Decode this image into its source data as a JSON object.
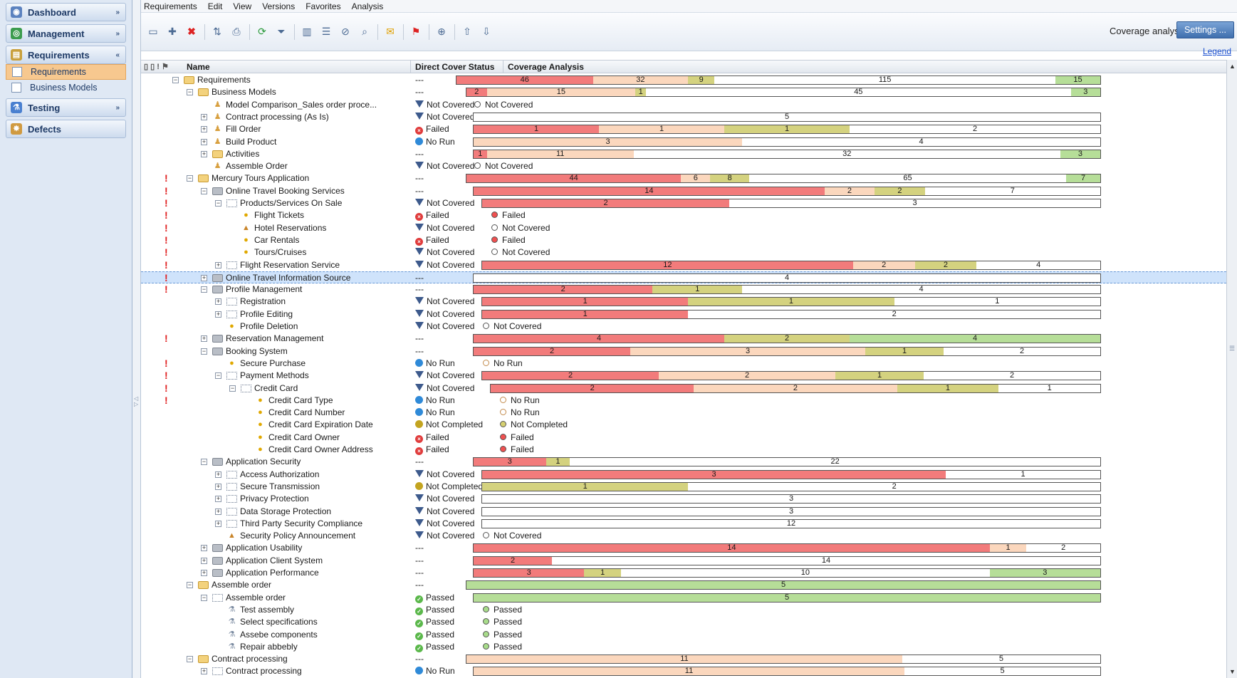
{
  "sidebar": {
    "items": [
      {
        "label": "Dashboard",
        "icon": "dashboard-icon",
        "chev": "»",
        "color": "#5b82bf"
      },
      {
        "label": "Management",
        "icon": "management-icon",
        "chev": "»",
        "color": "#3c9c4e"
      },
      {
        "label": "Requirements",
        "icon": "requirements-icon",
        "chev": "«",
        "color": "#c9a03c"
      },
      {
        "label": "Testing",
        "icon": "testing-icon",
        "chev": "»",
        "color": "#4a80d0"
      },
      {
        "label": "Defects",
        "icon": "defects-icon",
        "chev": "",
        "color": "#d09a40"
      }
    ],
    "sub": [
      "Requirements",
      "Business Models"
    ]
  },
  "menu": [
    "Requirements",
    "Edit",
    "View",
    "Versions",
    "Favorites",
    "Analysis"
  ],
  "toolbar": {
    "coverage_label": "Coverage analysis",
    "settings_label": "Settings ...",
    "legend_label": "Legend"
  },
  "columns": {
    "icons": "▯ ▯ ! ⚑",
    "name": "Name",
    "status": "Direct Cover Status",
    "coverage": "Coverage Analysis"
  },
  "colors": {
    "failed": "#f27b7b",
    "not_covered": "#fbd7bd",
    "not_completed": "#d4d27f",
    "passed": "#b6de98",
    "no_run": "#ffffff"
  },
  "rows": [
    {
      "lvl": 0,
      "exp": "-",
      "icon": "folder",
      "name": "Requirements",
      "status": "---",
      "bar": {
        "start": 0,
        "end": 1526,
        "segs": [
          [
            "f",
            "46",
            192
          ],
          [
            "nc",
            "32",
            134
          ],
          [
            "ncm",
            "9",
            37
          ],
          [
            "nr",
            "115",
            480
          ],
          [
            "p",
            "15",
            63
          ]
        ]
      }
    },
    {
      "lvl": 1,
      "exp": "-",
      "icon": "folder",
      "name": "Business Models",
      "status": "---",
      "bar": {
        "start": 0,
        "end": 1526,
        "segs": [
          [
            "f",
            "2",
            29
          ],
          [
            "nc",
            "15",
            212
          ],
          [
            "ncm",
            "1",
            15
          ],
          [
            "nr",
            "45",
            606
          ],
          [
            "p",
            "3",
            42
          ]
        ]
      }
    },
    {
      "lvl": 2,
      "exp": "",
      "icon": "person",
      "name": "Model Comparison_Sales order proce...",
      "status": "Not Covered",
      "st": "nc",
      "dot": {
        "cls": "nc",
        "label": "Not Covered"
      }
    },
    {
      "lvl": 2,
      "exp": "+",
      "icon": "person",
      "name": "Contract processing (As Is)",
      "status": "Not Covered",
      "st": "nc",
      "bar": {
        "segs": [
          [
            "nr",
            "5",
            1
          ]
        ]
      }
    },
    {
      "lvl": 2,
      "exp": "+",
      "icon": "person",
      "name": "Fill Order",
      "status": "Failed",
      "st": "failed",
      "bar": {
        "segs": [
          [
            "f",
            "1",
            1
          ],
          [
            "nc",
            "1",
            1
          ],
          [
            "ncm",
            "1",
            1
          ],
          [
            "nr",
            "2",
            2
          ]
        ]
      }
    },
    {
      "lvl": 2,
      "exp": "+",
      "icon": "person",
      "name": "Build Product",
      "status": "No Run",
      "st": "norun",
      "bar": {
        "segs": [
          [
            "nc",
            "3",
            3
          ],
          [
            "nr",
            "4",
            4
          ]
        ]
      }
    },
    {
      "lvl": 2,
      "exp": "+",
      "icon": "folder",
      "name": "Activities",
      "status": "---",
      "bar": {
        "segs": [
          [
            "f",
            "1",
            1
          ],
          [
            "nc",
            "11",
            11
          ],
          [
            "nr",
            "32",
            32
          ],
          [
            "p",
            "3",
            3
          ]
        ]
      }
    },
    {
      "lvl": 2,
      "exp": "",
      "icon": "person",
      "name": "Assemble Order",
      "status": "Not Covered",
      "st": "nc",
      "dot": {
        "cls": "nc",
        "label": "Not Covered"
      }
    },
    {
      "lvl": 1,
      "exp": "-",
      "icon": "folder",
      "name": "Mercury Tours Application",
      "status": "---",
      "mark": true,
      "bar": {
        "segs": [
          [
            "f",
            "44",
            44
          ],
          [
            "nc",
            "6",
            6
          ],
          [
            "ncm",
            "8",
            8
          ],
          [
            "nr",
            "65",
            65
          ],
          [
            "p",
            "7",
            7
          ]
        ]
      }
    },
    {
      "lvl": 2,
      "exp": "-",
      "icon": "gray",
      "name": "Online Travel Booking Services",
      "status": "---",
      "mark": true,
      "bar": {
        "segs": [
          [
            "f",
            "14",
            14
          ],
          [
            "nc",
            "2",
            2
          ],
          [
            "ncm",
            "2",
            2
          ],
          [
            "nr",
            "7",
            7
          ]
        ]
      }
    },
    {
      "lvl": 3,
      "exp": "-",
      "icon": "dots",
      "name": "Products/Services On Sale",
      "status": "Not Covered",
      "st": "nc",
      "mark": true,
      "bar": {
        "segs": [
          [
            "f",
            "2",
            2
          ],
          [
            "nr",
            "3",
            3
          ]
        ]
      }
    },
    {
      "lvl": 4,
      "exp": "",
      "icon": "bulb",
      "name": "Flight Tickets",
      "status": "Failed",
      "st": "failed",
      "mark": true,
      "dot": {
        "cls": "failed",
        "label": "Failed"
      }
    },
    {
      "lvl": 4,
      "exp": "",
      "icon": "lock",
      "name": "Hotel Reservations",
      "status": "Not Covered",
      "st": "nc",
      "mark": true,
      "dot": {
        "cls": "nc",
        "label": "Not Covered"
      }
    },
    {
      "lvl": 4,
      "exp": "",
      "icon": "bulb",
      "name": "Car Rentals",
      "status": "Failed",
      "st": "failed",
      "mark": true,
      "dot": {
        "cls": "failed",
        "label": "Failed"
      }
    },
    {
      "lvl": 4,
      "exp": "",
      "icon": "bulb",
      "name": "Tours/Cruises",
      "status": "Not Covered",
      "st": "nc",
      "mark": true,
      "dot": {
        "cls": "nc",
        "label": "Not Covered"
      }
    },
    {
      "lvl": 3,
      "exp": "+",
      "icon": "dots",
      "name": "Flight Reservation Service",
      "status": "Not Covered",
      "st": "nc",
      "mark": true,
      "bar": {
        "segs": [
          [
            "f",
            "12",
            12
          ],
          [
            "nc",
            "2",
            2
          ],
          [
            "ncm",
            "2",
            2
          ],
          [
            "nr",
            "4",
            4
          ]
        ]
      }
    },
    {
      "lvl": 2,
      "exp": "+",
      "icon": "gray",
      "name": "Online Travel Information Source",
      "status": "---",
      "sel": true,
      "mark": true,
      "bar": {
        "segs": [
          [
            "nr",
            "4",
            4
          ]
        ]
      }
    },
    {
      "lvl": 2,
      "exp": "-",
      "icon": "gray",
      "name": "Profile Management",
      "status": "---",
      "mark": true,
      "bar": {
        "segs": [
          [
            "f",
            "2",
            2
          ],
          [
            "ncm",
            "1",
            1
          ],
          [
            "nr",
            "4",
            4
          ]
        ]
      }
    },
    {
      "lvl": 3,
      "exp": "+",
      "icon": "dots",
      "name": "Registration",
      "status": "Not Covered",
      "st": "nc",
      "bar": {
        "segs": [
          [
            "f",
            "1",
            1
          ],
          [
            "ncm",
            "1",
            1
          ],
          [
            "nr",
            "1",
            1
          ]
        ]
      }
    },
    {
      "lvl": 3,
      "exp": "+",
      "icon": "dots",
      "name": "Profile Editing",
      "status": "Not Covered",
      "st": "nc",
      "bar": {
        "segs": [
          [
            "f",
            "1",
            1
          ],
          [
            "nr",
            "2",
            2
          ]
        ]
      }
    },
    {
      "lvl": 3,
      "exp": "",
      "icon": "bulb",
      "name": "Profile Deletion",
      "status": "Not Covered",
      "st": "nc",
      "dot": {
        "cls": "nc",
        "label": "Not Covered"
      }
    },
    {
      "lvl": 2,
      "exp": "+",
      "icon": "gray",
      "name": "Reservation Management",
      "status": "---",
      "mark": true,
      "bar": {
        "segs": [
          [
            "f",
            "4",
            4
          ],
          [
            "ncm",
            "2",
            2
          ],
          [
            "p",
            "4",
            4
          ]
        ]
      }
    },
    {
      "lvl": 2,
      "exp": "-",
      "icon": "gray",
      "name": "Booking System",
      "status": "---",
      "bar": {
        "segs": [
          [
            "f",
            "2",
            2
          ],
          [
            "nc",
            "3",
            3
          ],
          [
            "ncm",
            "1",
            1
          ],
          [
            "nr",
            "2",
            2
          ]
        ]
      }
    },
    {
      "lvl": 3,
      "exp": "",
      "icon": "bulb",
      "name": "Secure Purchase",
      "status": "No Run",
      "st": "norun",
      "mark": true,
      "dot": {
        "cls": "norun",
        "label": "No Run"
      }
    },
    {
      "lvl": 3,
      "exp": "-",
      "icon": "dots",
      "name": "Payment Methods",
      "status": "Not Covered",
      "st": "nc",
      "mark": true,
      "bar": {
        "segs": [
          [
            "f",
            "2",
            2
          ],
          [
            "nc",
            "2",
            2
          ],
          [
            "ncm",
            "1",
            1
          ],
          [
            "nr",
            "2",
            2
          ]
        ]
      }
    },
    {
      "lvl": 4,
      "exp": "-",
      "icon": "dots",
      "name": "Credit Card",
      "status": "Not Covered",
      "st": "nc",
      "mark": true,
      "bar": {
        "segs": [
          [
            "f",
            "2",
            2
          ],
          [
            "nc",
            "2",
            2
          ],
          [
            "ncm",
            "1",
            1
          ],
          [
            "nr",
            "1",
            1
          ]
        ]
      }
    },
    {
      "lvl": 5,
      "exp": "",
      "icon": "bulb",
      "name": "Credit Card Type",
      "status": "No Run",
      "st": "norun",
      "mark": true,
      "dot": {
        "cls": "norun",
        "label": "No Run"
      }
    },
    {
      "lvl": 5,
      "exp": "",
      "icon": "bulb",
      "name": "Credit Card Number",
      "status": "No Run",
      "st": "norun",
      "dot": {
        "cls": "norun",
        "label": "No Run"
      }
    },
    {
      "lvl": 5,
      "exp": "",
      "icon": "bulb",
      "name": "Credit Card Expiration Date",
      "status": "Not Completed",
      "st": "notcomp",
      "dot": {
        "cls": "notcomp",
        "label": "Not Completed"
      }
    },
    {
      "lvl": 5,
      "exp": "",
      "icon": "bulb",
      "name": "Credit Card Owner",
      "status": "Failed",
      "st": "failed",
      "dot": {
        "cls": "failed",
        "label": "Failed"
      }
    },
    {
      "lvl": 5,
      "exp": "",
      "icon": "bulb",
      "name": "Credit Card Owner Address",
      "status": "Failed",
      "st": "failed",
      "dot": {
        "cls": "failed",
        "label": "Failed"
      }
    },
    {
      "lvl": 2,
      "exp": "-",
      "icon": "gray",
      "name": "Application Security",
      "status": "---",
      "bar": {
        "segs": [
          [
            "f",
            "3",
            3
          ],
          [
            "ncm",
            "1",
            1
          ],
          [
            "nr",
            "22",
            22
          ]
        ]
      }
    },
    {
      "lvl": 3,
      "exp": "+",
      "icon": "dots",
      "name": "Access Authorization",
      "status": "Not Covered",
      "st": "nc",
      "bar": {
        "segs": [
          [
            "f",
            "3",
            3
          ],
          [
            "nr",
            "1",
            1
          ]
        ]
      }
    },
    {
      "lvl": 3,
      "exp": "+",
      "icon": "dots",
      "name": "Secure Transmission",
      "status": "Not Completed",
      "st": "notcomp",
      "bar": {
        "segs": [
          [
            "ncm",
            "1",
            1
          ],
          [
            "nr",
            "2",
            2
          ]
        ]
      }
    },
    {
      "lvl": 3,
      "exp": "+",
      "icon": "dots",
      "name": "Privacy Protection",
      "status": "Not Covered",
      "st": "nc",
      "bar": {
        "segs": [
          [
            "nr",
            "3",
            3
          ]
        ]
      }
    },
    {
      "lvl": 3,
      "exp": "+",
      "icon": "dots",
      "name": "Data Storage Protection",
      "status": "Not Covered",
      "st": "nc",
      "bar": {
        "segs": [
          [
            "nr",
            "3",
            3
          ]
        ]
      }
    },
    {
      "lvl": 3,
      "exp": "+",
      "icon": "dots",
      "name": "Third Party Security Compliance",
      "status": "Not Covered",
      "st": "nc",
      "bar": {
        "segs": [
          [
            "nr",
            "12",
            12
          ]
        ]
      }
    },
    {
      "lvl": 3,
      "exp": "",
      "icon": "lock",
      "name": "Security Policy Announcement",
      "status": "Not Covered",
      "st": "nc",
      "dot": {
        "cls": "nc",
        "label": "Not Covered"
      }
    },
    {
      "lvl": 2,
      "exp": "+",
      "icon": "gray",
      "name": "Application Usability",
      "status": "---",
      "bar": {
        "segs": [
          [
            "f",
            "14",
            14
          ],
          [
            "nc",
            "1",
            1
          ],
          [
            "nr",
            "2",
            2
          ]
        ]
      }
    },
    {
      "lvl": 2,
      "exp": "+",
      "icon": "gray",
      "name": "Application Client System",
      "status": "---",
      "bar": {
        "segs": [
          [
            "f",
            "2",
            2
          ],
          [
            "nr",
            "14",
            14
          ]
        ]
      }
    },
    {
      "lvl": 2,
      "exp": "+",
      "icon": "gray",
      "name": "Application Performance",
      "status": "---",
      "bar": {
        "segs": [
          [
            "f",
            "3",
            3
          ],
          [
            "ncm",
            "1",
            1
          ],
          [
            "nr",
            "10",
            10
          ],
          [
            "p",
            "3",
            3
          ]
        ]
      }
    },
    {
      "lvl": 1,
      "exp": "-",
      "icon": "folder",
      "name": "Assemble order",
      "status": "---",
      "bar": {
        "segs": [
          [
            "p",
            "5",
            5
          ]
        ]
      }
    },
    {
      "lvl": 2,
      "exp": "-",
      "icon": "dots",
      "name": "Assemble order",
      "status": "Passed",
      "st": "passed",
      "bar": {
        "segs": [
          [
            "p",
            "5",
            5
          ]
        ]
      }
    },
    {
      "lvl": 3,
      "exp": "",
      "icon": "flask",
      "name": "Test assembly",
      "status": "Passed",
      "st": "passed",
      "dot": {
        "cls": "passed",
        "label": "Passed"
      }
    },
    {
      "lvl": 3,
      "exp": "",
      "icon": "flask",
      "name": "Select specifications",
      "status": "Passed",
      "st": "passed",
      "dot": {
        "cls": "passed",
        "label": "Passed"
      }
    },
    {
      "lvl": 3,
      "exp": "",
      "icon": "flask",
      "name": "Assebe components",
      "status": "Passed",
      "st": "passed",
      "dot": {
        "cls": "passed",
        "label": "Passed"
      }
    },
    {
      "lvl": 3,
      "exp": "",
      "icon": "flask",
      "name": "Repair abbebly",
      "status": "Passed",
      "st": "passed",
      "dot": {
        "cls": "passed",
        "label": "Passed"
      }
    },
    {
      "lvl": 1,
      "exp": "-",
      "icon": "folder",
      "name": "Contract processing",
      "status": "---",
      "bar": {
        "segs": [
          [
            "nc",
            "11",
            11
          ],
          [
            "nr",
            "5",
            5
          ]
        ]
      }
    },
    {
      "lvl": 2,
      "exp": "+",
      "icon": "dots",
      "name": "Contract processing",
      "status": "No Run",
      "st": "norun",
      "bar": {
        "segs": [
          [
            "nc",
            "11",
            11
          ],
          [
            "nr",
            "5",
            5
          ]
        ]
      }
    }
  ]
}
